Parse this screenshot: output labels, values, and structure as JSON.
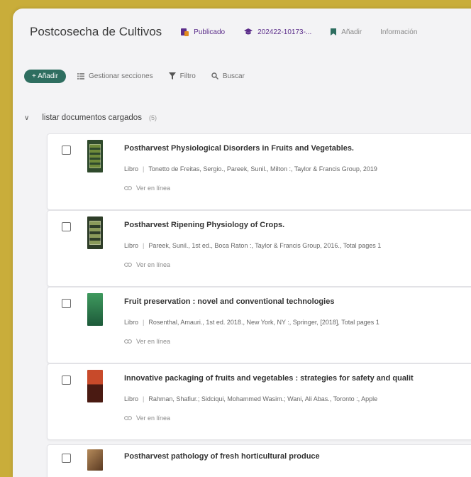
{
  "header": {
    "title": "Postcosecha de Cultivos",
    "status": "Publicado",
    "code": "202422-10173-...",
    "add_label": "Añadir",
    "info_label": "Información"
  },
  "toolbar": {
    "add_button": "+ Añadir",
    "manage_sections": "Gestionar secciones",
    "filter": "Filtro",
    "search": "Buscar"
  },
  "section": {
    "title": "listar documentos cargados",
    "count": "(5)"
  },
  "items": [
    {
      "title": "Postharvest Physiological Disorders in Fruits and Vegetables.",
      "type": "Libro",
      "details": "Tonetto de Freitas, Sergio., Pareek, Sunil., Milton :, Taylor & Francis Group, 2019",
      "link": "Ver en línea",
      "cover_color": "#2f4a2c"
    },
    {
      "title": "Postharvest Ripening Physiology of Crops.",
      "type": "Libro",
      "details": "Pareek, Sunil., 1st ed., Boca Raton :, Taylor & Francis Group, 2016., Total pages 1",
      "link": "Ver en línea",
      "cover_color": "#2e3d28"
    },
    {
      "title": "Fruit preservation : novel and conventional technologies",
      "type": "Libro",
      "details": "Rosenthal, Amauri., 1st ed. 2018., New York, NY :, Springer, [2018], Total pages 1",
      "link": "Ver en línea",
      "cover_color": "#2f7a4c"
    },
    {
      "title": "Innovative packaging of fruits and vegetables : strategies for safety and qualit",
      "type": "Libro",
      "details": "Rahman, Shafiur.; Sidciqui, Mohammed Wasim.; Wani, Ali Abas., Toronto :, Apple",
      "link": "Ver en línea",
      "cover_color": "#a8321e"
    },
    {
      "title": "Postharvest pathology of fresh horticultural produce",
      "cover_color": "#7a5a3a"
    }
  ],
  "colors": {
    "accent": "#2e6e60",
    "purple": "#5b2d8a",
    "background": "#c9ad3a"
  }
}
